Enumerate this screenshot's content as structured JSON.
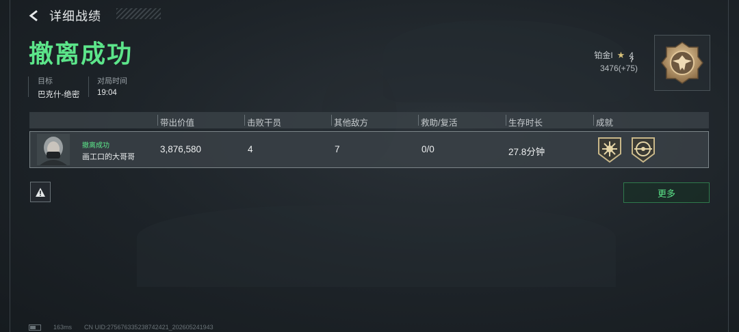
{
  "header": {
    "title": "详细战绩",
    "back_icon": "back-arrow-icon"
  },
  "result": {
    "title": "撤离成功",
    "color": "#5ce58a"
  },
  "match_info": [
    {
      "label": "目标",
      "value": "巴克什-绝密"
    },
    {
      "label": "对局时间",
      "value": "19:04"
    }
  ],
  "rank": {
    "tier": "铂金I",
    "star_icon": "star-icon",
    "stars": "4",
    "score": "3476(+75)",
    "help": "?"
  },
  "table": {
    "headers": [
      "带出价值",
      "击败干员",
      "其他敌方",
      "救助/复活",
      "生存时长",
      "成就"
    ],
    "row": {
      "status": "撤离成功",
      "name": "画工口的大哥哥",
      "value": "3,876,580",
      "kills": "4",
      "other_enemies": "7",
      "rescue_revive": "0/0",
      "survival_time": "27.8分钟",
      "achievements": [
        "sunburst-badge-icon",
        "compass-badge-icon"
      ]
    }
  },
  "actions": {
    "more_label": "更多",
    "report_icon": "warning-triangle-icon"
  },
  "footer": {
    "ping": "163ms",
    "uid": "CN UID:275676335238742421_202605241943"
  }
}
